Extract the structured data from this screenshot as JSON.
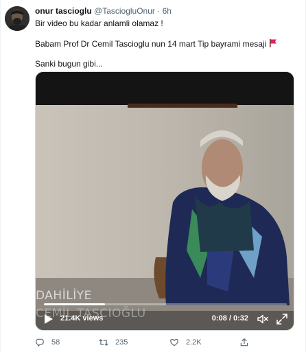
{
  "tweet": {
    "author_name": "onur tascioglu",
    "author_handle": "@TasciogluOnur",
    "separator": "·",
    "time": "6h",
    "line1": "Bir video bu kadar anlamli olamaz !",
    "line2": "Babam Prof Dr Cemil Tascioglu nun 14 mart Tip bayrami mesaji",
    "line3": "Sanki bugun gibi..."
  },
  "video": {
    "caption_line1": "DAHİLİYE",
    "caption_line2": "CEMİL TAŞCIOĞLU",
    "views": "21.4K views",
    "timer": "0:08 / 0:32",
    "progress": 0.25
  },
  "actions": {
    "replies": "58",
    "retweets": "235",
    "likes": "2.2K"
  },
  "colors": {
    "secondary_text": "#536471",
    "flag_red": "#e0245e"
  },
  "icons": [
    "avatar",
    "flag-icon",
    "play-icon",
    "volume-icon",
    "fullscreen-icon",
    "reply-icon",
    "retweet-icon",
    "like-icon",
    "share-icon"
  ]
}
